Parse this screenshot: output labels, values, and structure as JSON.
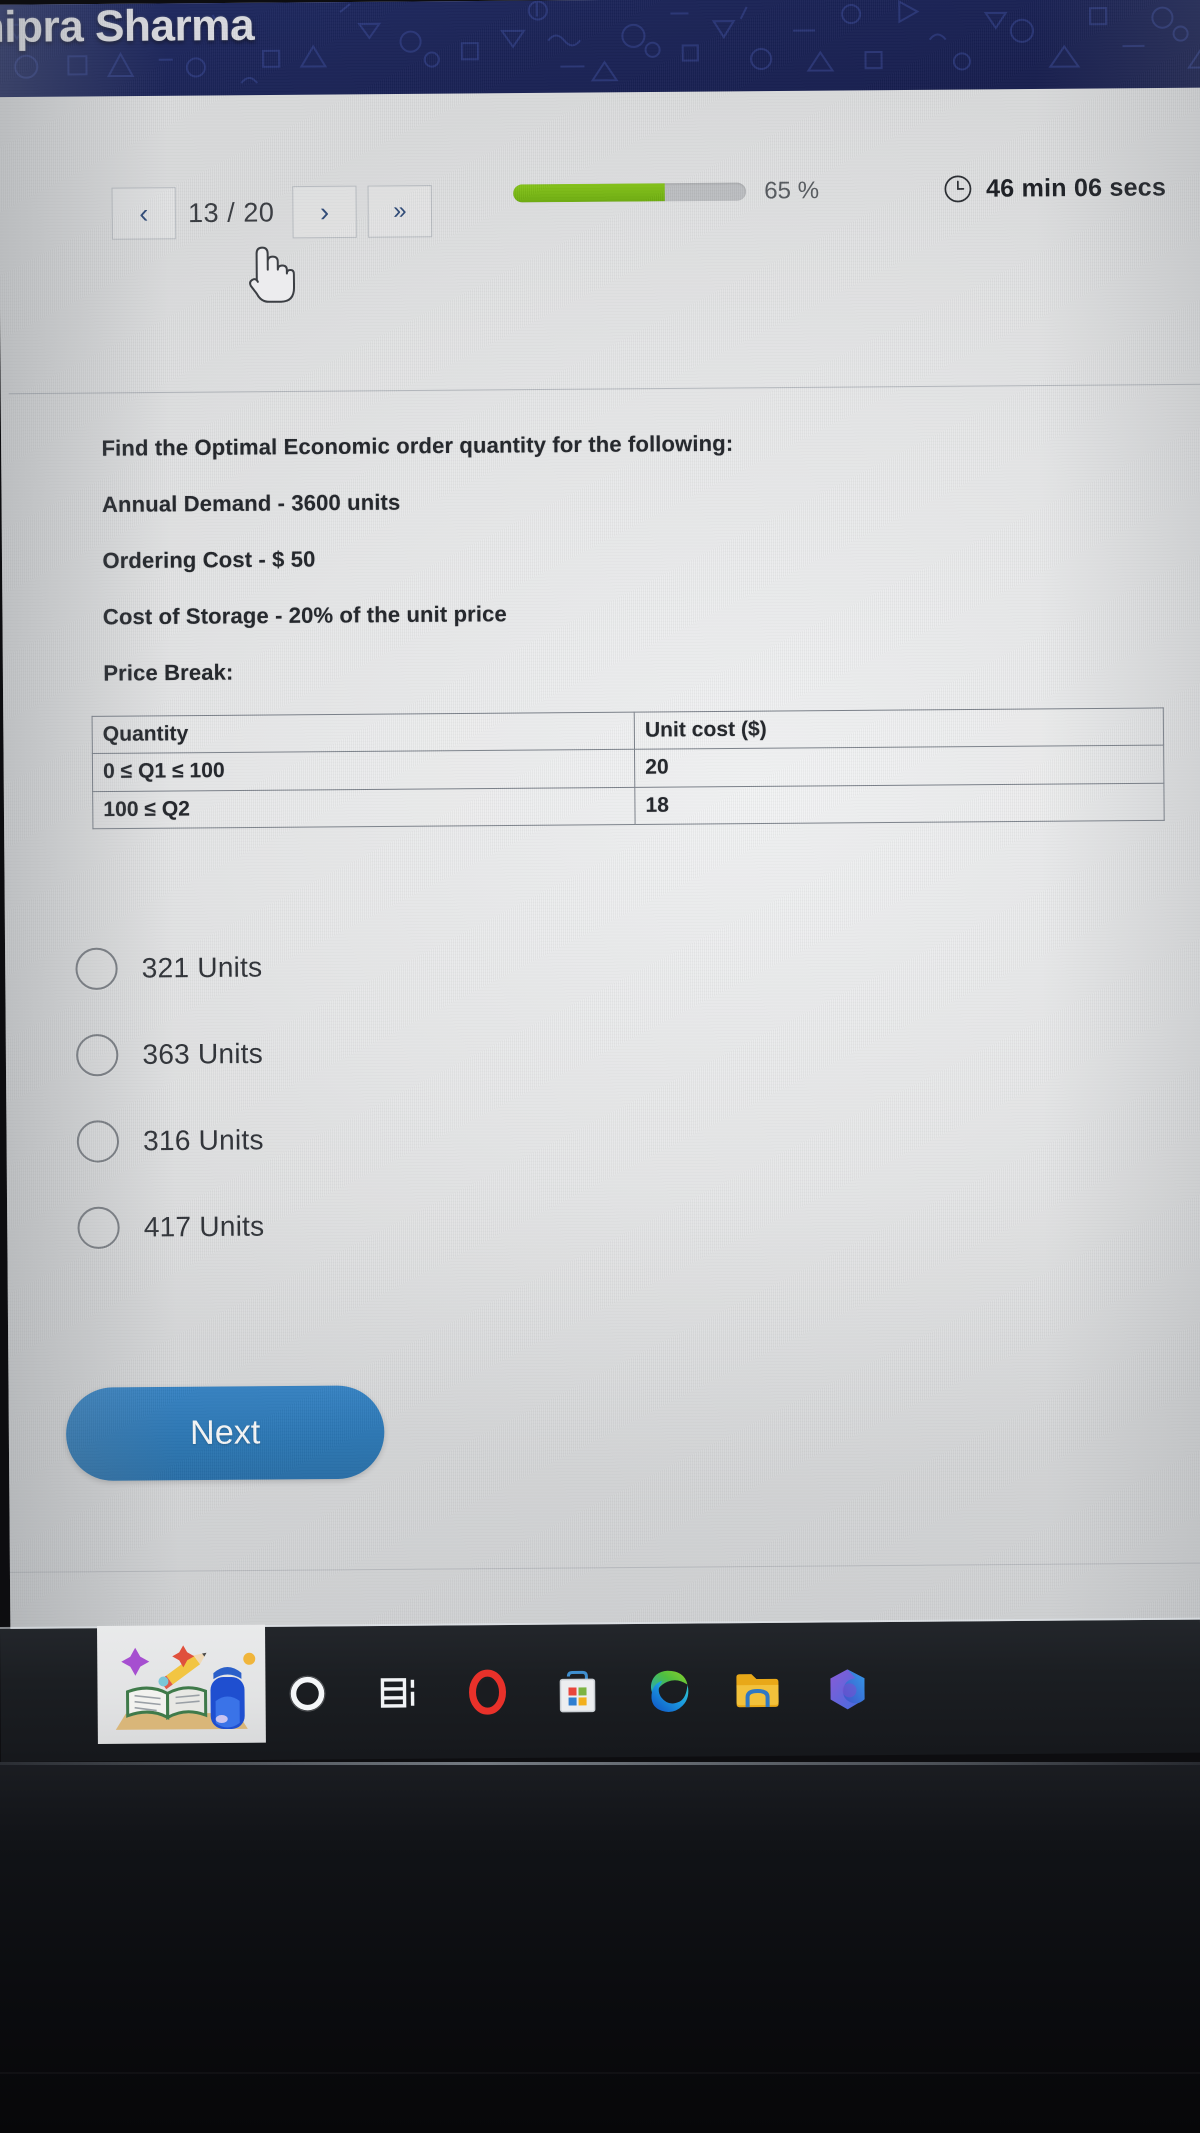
{
  "banner": {
    "title": "hipra Sharma"
  },
  "toolbar": {
    "prev_label": "‹",
    "next_label": "›",
    "last_label": "»",
    "page_counter": "13 / 20",
    "progress_percent_label": "65 %",
    "progress_percent_value": 65,
    "timer_label": "46 min 06 secs",
    "clock_icon": "clock-icon"
  },
  "question": {
    "prompt": "Find the Optimal Economic order quantity for the following:",
    "lines": [
      "Annual Demand - 3600 units",
      "Ordering Cost - $ 50",
      "Cost of Storage - 20% of the unit price"
    ],
    "price_break_label": "Price Break:",
    "table": {
      "headers": [
        "Quantity",
        "Unit cost ($)"
      ],
      "rows": [
        [
          "0 ≤ Q1 ≤ 100",
          "20"
        ],
        [
          "100 ≤ Q2",
          "18"
        ]
      ]
    }
  },
  "options": [
    {
      "label": "321 Units",
      "selected": false
    },
    {
      "label": "363 Units",
      "selected": false
    },
    {
      "label": "316 Units",
      "selected": false
    },
    {
      "label": "417 Units",
      "selected": false
    }
  ],
  "actions": {
    "next_button": "Next"
  },
  "taskbar": {
    "icons": [
      {
        "name": "cortana-icon"
      },
      {
        "name": "task-view-icon"
      },
      {
        "name": "opera-icon"
      },
      {
        "name": "microsoft-store-icon"
      },
      {
        "name": "microsoft-edge-icon"
      },
      {
        "name": "file-explorer-icon"
      },
      {
        "name": "microsoft-365-icon"
      }
    ],
    "widget": {
      "name": "school-widget-icon"
    }
  },
  "colors": {
    "banner": "#1b2458",
    "progress_fill": "#7bbd16",
    "progress_track": "#bcbec1",
    "next_button": "#2274b6",
    "page_background": "#e7e8e9",
    "taskbar": "#1b1e22"
  }
}
